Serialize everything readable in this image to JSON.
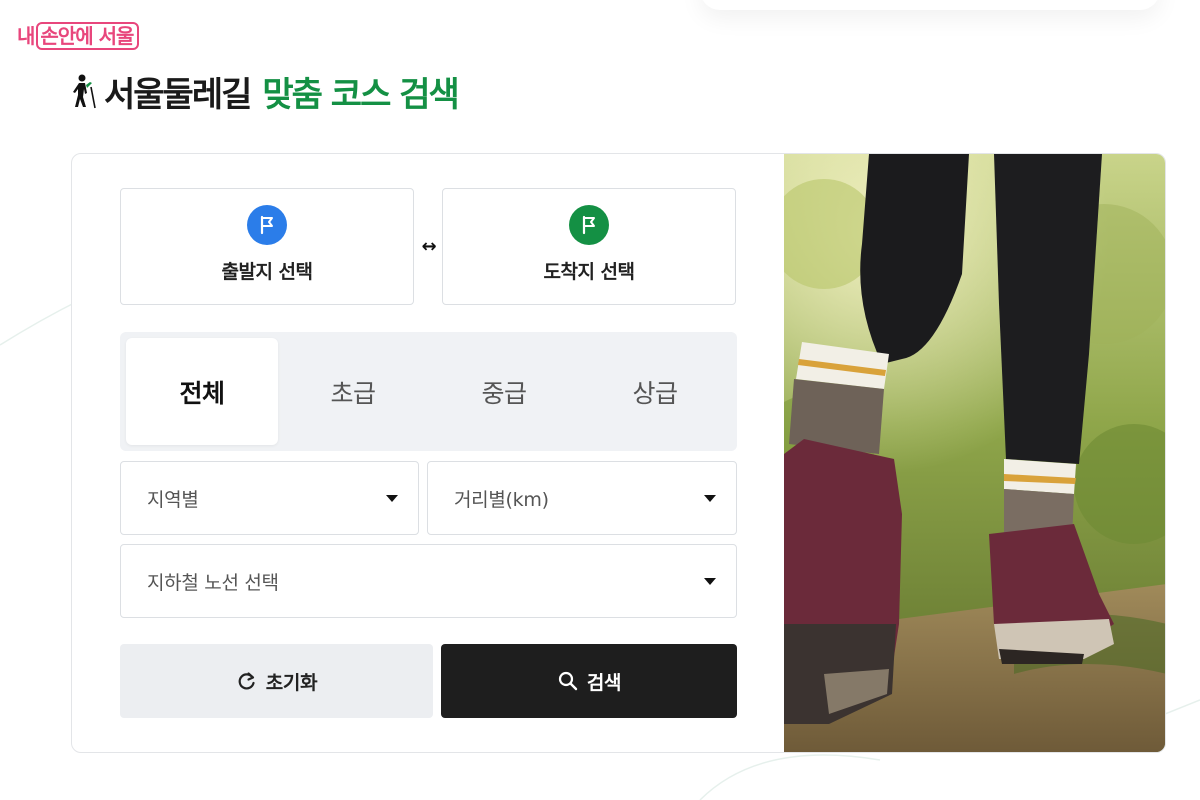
{
  "brand": {
    "prefix": "내",
    "boxed": "손안에 서울",
    "color": "#e8467c"
  },
  "title": {
    "main": "서울둘레길",
    "accent": "맞춤 코스 검색",
    "icon": "hiker-icon",
    "accent_color": "#149044"
  },
  "locations": {
    "start": {
      "label": "출발지 선택",
      "icon": "flag-icon",
      "color": "#2b7de9"
    },
    "swap_icon": "swap-arrow-icon",
    "end": {
      "label": "도착지 선택",
      "icon": "flag-icon",
      "color": "#149044"
    }
  },
  "levels": {
    "items": [
      {
        "label": "전체",
        "active": true
      },
      {
        "label": "초급",
        "active": false
      },
      {
        "label": "중급",
        "active": false
      },
      {
        "label": "상급",
        "active": false
      }
    ]
  },
  "filters": {
    "region": {
      "value": "지역별",
      "icon": "caret-down-icon"
    },
    "distance": {
      "value": "거리별(km)",
      "icon": "caret-down-icon"
    },
    "subway": {
      "value": "지하철 노선 선택",
      "icon": "caret-down-icon"
    }
  },
  "actions": {
    "reset": {
      "label": "초기화",
      "icon": "refresh-icon"
    },
    "search": {
      "label": "검색",
      "icon": "search-icon"
    }
  },
  "photo": {
    "subject": "hiking-boots-photo"
  }
}
